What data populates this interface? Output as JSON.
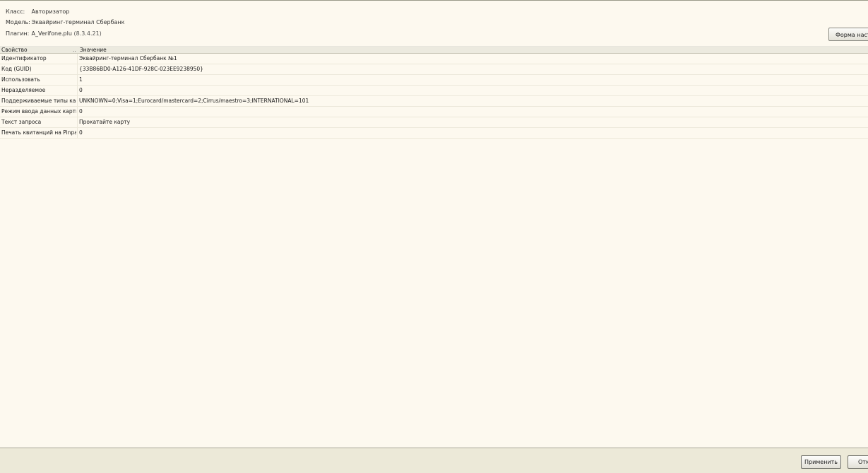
{
  "info": {
    "class_label": "Класс:",
    "class_value": "Авторизатор",
    "model_label": "Модель:",
    "model_value": "Эквайринг-терминал Сбербанк",
    "plugin_label": "Плагин:",
    "plugin_value": "A_Verifone.plu",
    "plugin_version": "(8.3.4.21)"
  },
  "toolbar": {
    "settings_form_label": "Форма настро"
  },
  "grid": {
    "header": {
      "property": "Свойство",
      "sort_marker": "..",
      "value": "Значение"
    },
    "rows": [
      {
        "property": "Идентификатор",
        "value": "Эквайринг-терминал Сбербанк №1"
      },
      {
        "property": "Код (GUID)",
        "value": "{33B86BD0-A126-41DF-928C-023EE9238950}"
      },
      {
        "property": "Использовать",
        "value": "1"
      },
      {
        "property": "Неразделяемое",
        "value": "0"
      },
      {
        "property": "Поддерживаемые типы карт",
        "value": "UNKNOWN=0;Visa=1;Eurocard/mastercard=2;Cirrus/maestro=3;INTERNATIONAL=101"
      },
      {
        "property": "Режим ввода данных карты",
        "value": "0"
      },
      {
        "property": "Текст запроса",
        "value": "Прокатайте карту"
      },
      {
        "property": "Печать квитанций на Pinpad",
        "value": "0"
      }
    ]
  },
  "footer": {
    "apply_label": "Применить",
    "cancel_label": "Отм"
  }
}
